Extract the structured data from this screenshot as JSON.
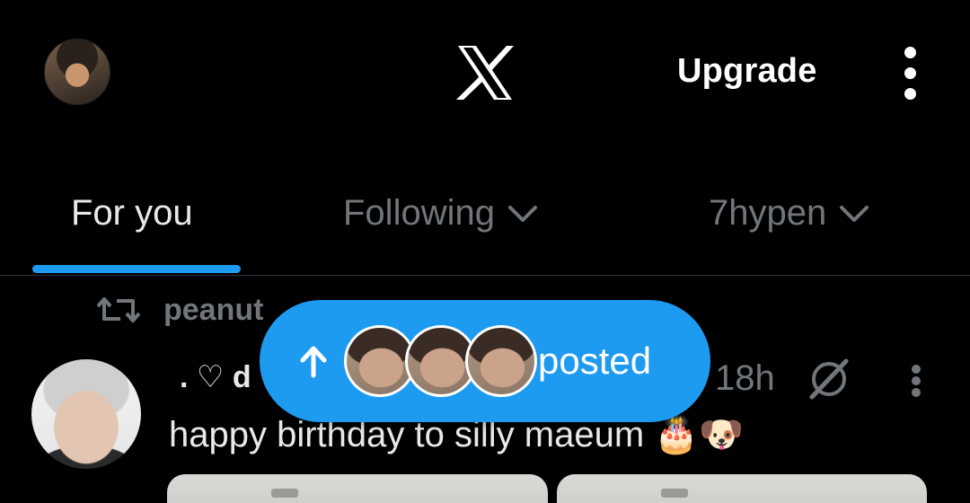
{
  "header": {
    "profile_avatar": "profile-photo",
    "logo_icon": "x-logo-icon",
    "upgrade_label": "Upgrade",
    "more_icon": "vertical-dots-icon"
  },
  "tabs": [
    {
      "label": "For you",
      "active": true
    },
    {
      "label": "Following",
      "active": false,
      "has_dropdown": true
    },
    {
      "label": "7hypen",
      "active": false,
      "has_dropdown": true
    }
  ],
  "post": {
    "retweet_label": "peanut",
    "author_display": ". ♡ d",
    "time": "18h",
    "text": "happy birthday to silly maeum 🎂🐶",
    "icons": [
      "retweet-icon",
      "grok-icon",
      "vertical-dots-icon"
    ]
  },
  "new_posts_pill": {
    "label": "posted",
    "icon": "arrow-up-icon",
    "avatar_count": 3
  },
  "colors": {
    "background": "#000000",
    "accent": "#1d9bf0",
    "text_primary": "#e7e9ea",
    "text_secondary": "#71767b",
    "divider": "#2f3336"
  }
}
